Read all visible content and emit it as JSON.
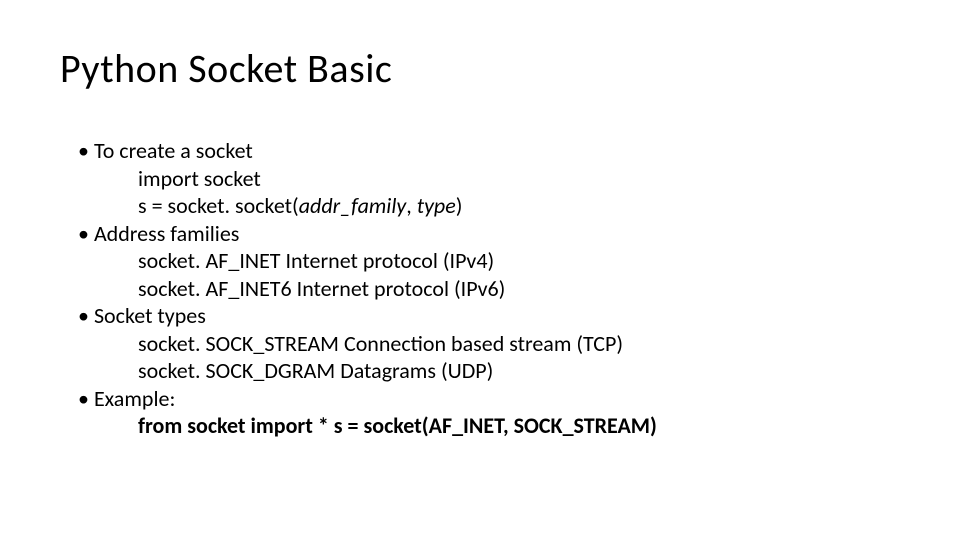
{
  "title": "Python Socket Basic",
  "bullets": {
    "b1": {
      "head": "To create a socket",
      "l1": "import socket",
      "l2a": "s = socket. socket(",
      "l2b": "addr_family",
      "l2c": ", ",
      "l2d": "type",
      "l2e": ")"
    },
    "b2": {
      "head": "Address families",
      "l1": "socket. AF_INET Internet protocol (IPv4)",
      "l2": "socket. AF_INET6 Internet protocol (IPv6)"
    },
    "b3": {
      "head": "Socket types",
      "l1": "socket. SOCK_STREAM Connection based stream (TCP)",
      "l2": "socket. SOCK_DGRAM Datagrams (UDP)"
    },
    "b4": {
      "head": "Example:",
      "l1": "from socket import * s = socket(AF_INET, SOCK_STREAM)"
    }
  }
}
